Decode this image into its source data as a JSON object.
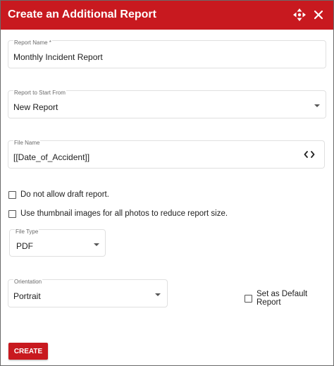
{
  "dialog": {
    "title": "Create an Additional Report",
    "icons": {
      "move": "move-arrows-icon",
      "close": "close-icon"
    }
  },
  "fields": {
    "report_name": {
      "label": "Report Name *",
      "value": "Monthly Incident Report"
    },
    "report_start": {
      "label": "Report to Start From",
      "value": "New Report"
    },
    "file_name": {
      "label": "File Name",
      "value": "[[Date_of_Accident]]",
      "icon": "code-brackets-icon"
    },
    "file_type": {
      "label": "File Type",
      "value": "PDF"
    },
    "orientation": {
      "label": "Orientation",
      "value": "Portrait"
    }
  },
  "checkboxes": {
    "no_draft": {
      "label": "Do not allow draft report.",
      "checked": false
    },
    "thumbnails": {
      "label": "Use thumbnail images for all photos to reduce report size.",
      "checked": false
    },
    "default_report": {
      "label": "Set as Default Report",
      "checked": false
    }
  },
  "actions": {
    "create_label": "CREATE"
  },
  "colors": {
    "brand": "#c8191f",
    "border": "#e0e0e0",
    "text": "#212121",
    "label": "#6b6b6b"
  }
}
